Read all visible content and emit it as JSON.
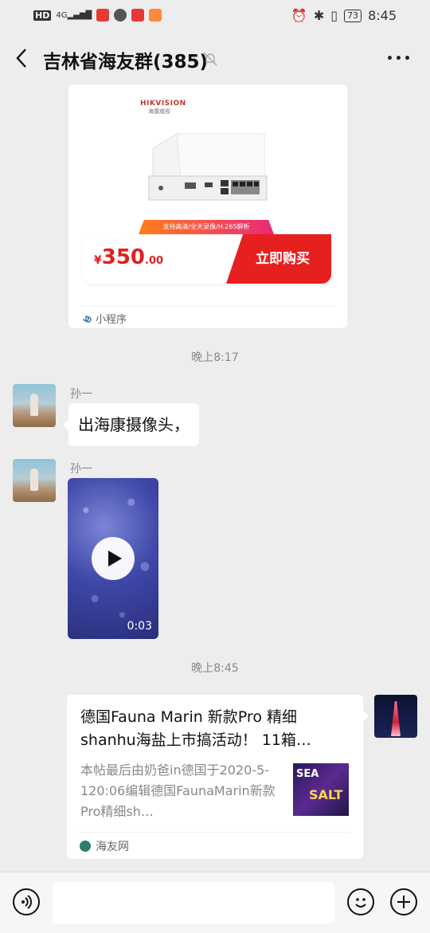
{
  "status_bar": {
    "battery": "73",
    "time": "8:45"
  },
  "header": {
    "title": "吉林省海友群(385)"
  },
  "product_card": {
    "brand": "HIKVISION",
    "brand_sub": "海康威视",
    "strip_text": "支持高清/全天录像/H.265解析",
    "price_symbol": "¥",
    "price_int": "350",
    "price_dec": ".00",
    "buy_label": "立即购买",
    "mini_program_label": "小程序"
  },
  "timestamps": [
    "晚上8:17",
    "晚上8:45"
  ],
  "messages": [
    {
      "sender": "孙一",
      "text": "出海康摄像头，"
    },
    {
      "sender": "孙一",
      "video_duration": "0:03"
    }
  ],
  "link_card": {
    "title": "德国Fauna Marin 新款Pro 精细shanhu海盐上市搞活动！ 11箱…",
    "desc": "本帖最后由奶爸in德国于2020-5-120:06编辑德国FaunaMarin新款Pro精细sh…",
    "source": "海友网",
    "thumb_words": [
      "SEA",
      "SALT"
    ]
  }
}
